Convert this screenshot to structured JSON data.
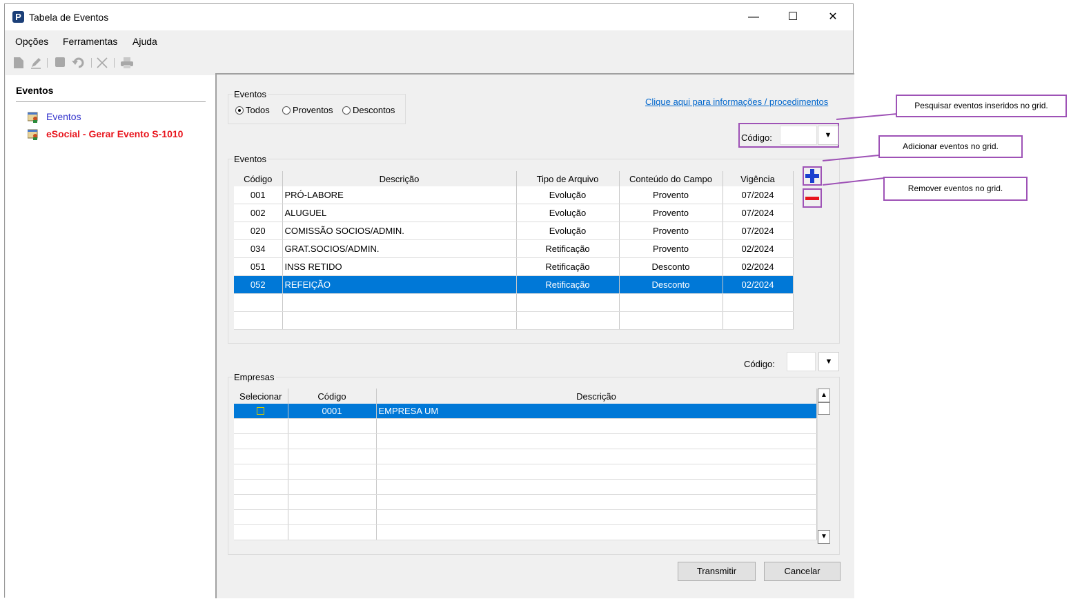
{
  "window": {
    "title": "Tabela de Eventos",
    "app_icon": "P",
    "minimize": "—",
    "maximize": "☐",
    "close": "✕"
  },
  "menu": [
    {
      "label": "Opções"
    },
    {
      "label": "Ferramentas"
    },
    {
      "label": "Ajuda"
    }
  ],
  "toolbar_icons": [
    "new-icon",
    "edit-icon",
    "save-icon",
    "undo-icon",
    "delete-icon",
    "print-icon"
  ],
  "left_panel": {
    "title": "Eventos",
    "items": [
      {
        "label": "Eventos",
        "color": "#3333cc"
      },
      {
        "label": "eSocial - Gerar Evento S-1010",
        "color": "#e8141c"
      }
    ]
  },
  "filter": {
    "group_label": "Eventos",
    "options": [
      "Todos",
      "Proventos",
      "Descontos"
    ],
    "selected": "Todos"
  },
  "info_link": "Clique aqui para informações / procedimentos",
  "search_top": {
    "label": "Código:",
    "value": ""
  },
  "events_grid": {
    "group_label": "Eventos",
    "columns": [
      "Código",
      "Descrição",
      "Tipo de Arquivo",
      "Conteúdo do Campo",
      "Vigência"
    ],
    "rows": [
      [
        "001",
        "PRÓ-LABORE",
        "Evolução",
        "Provento",
        "07/2024"
      ],
      [
        "002",
        "ALUGUEL",
        "Evolução",
        "Provento",
        "07/2024"
      ],
      [
        "020",
        "COMISSÃO SOCIOS/ADMIN.",
        "Evolução",
        "Provento",
        "07/2024"
      ],
      [
        "034",
        "GRAT.SOCIOS/ADMIN.",
        "Retificação",
        "Provento",
        "02/2024"
      ],
      [
        "051",
        "INSS RETIDO",
        "Retificação",
        "Desconto",
        "02/2024"
      ],
      [
        "052",
        "REFEIÇÃO",
        "Retificação",
        "Desconto",
        "02/2024"
      ]
    ],
    "selected_row": 5,
    "empty_rows": 2
  },
  "search_bottom": {
    "label": "Código:",
    "value": ""
  },
  "companies_grid": {
    "group_label": "Empresas",
    "columns": [
      "Selecionar",
      "Código",
      "Descrição"
    ],
    "rows": [
      [
        "",
        "0001",
        "EMPRESA UM"
      ]
    ],
    "selected_row": 0,
    "empty_rows": 8
  },
  "buttons": {
    "add": "+",
    "remove": "−",
    "transmit": "Transmitir",
    "cancel": "Cancelar"
  },
  "callouts": {
    "search": "Pesquisar eventos inseridos no grid.",
    "add": "Adicionar eventos no grid.",
    "remove": "Remover eventos no grid."
  },
  "colors": {
    "selection": "#0078d7",
    "callout_border": "#9e52b6",
    "add_icon": "#1a3fcf",
    "remove_icon": "#e8141c"
  }
}
